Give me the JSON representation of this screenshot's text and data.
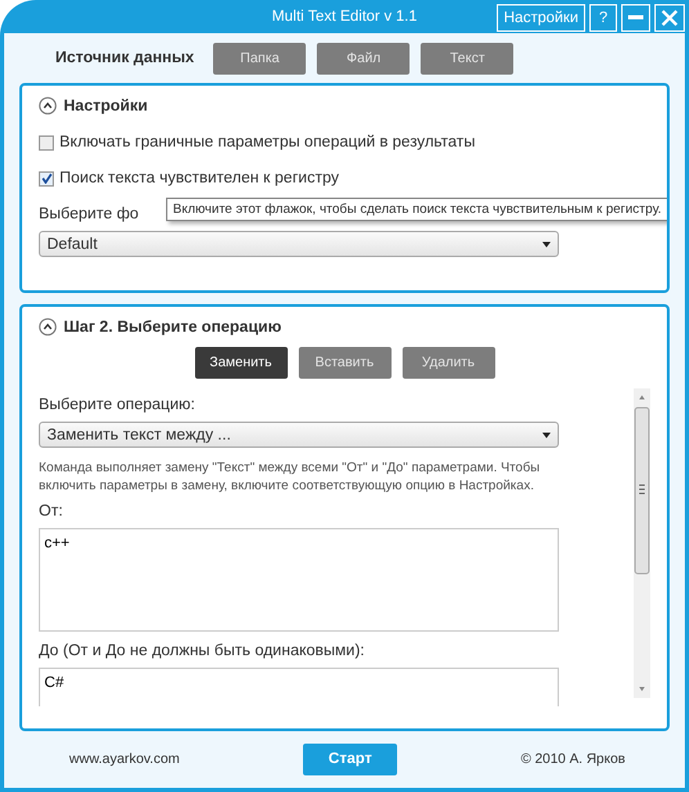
{
  "window": {
    "title": "Multi Text Editor v 1.1",
    "buttons": [
      {
        "kind": "text",
        "label": "Настройки"
      },
      {
        "kind": "text",
        "label": "?"
      },
      {
        "kind": "minimize"
      },
      {
        "kind": "close"
      }
    ]
  },
  "data_source": {
    "label": "Источник данных",
    "buttons": [
      {
        "label": "Папка",
        "disabled": true
      },
      {
        "label": "Файл",
        "disabled": true
      },
      {
        "label": "Текст",
        "disabled": true
      }
    ]
  },
  "settings": {
    "title": "Настройки",
    "expanded": true,
    "checkboxes": [
      {
        "label": "Включать граничные параметры операций в результаты",
        "checked": false
      },
      {
        "label": "Поиск текста чувствителен к регистру",
        "checked": true
      }
    ],
    "format_label": "Выберите фо",
    "tooltip": "Включите этот флажок, чтобы сделать поиск текста чувствительным к регистру.",
    "format_select": "Default"
  },
  "step2": {
    "title": "Шаг 2. Выберите операцию",
    "expanded": true,
    "operations": [
      {
        "label": "Заменить",
        "selected": true
      },
      {
        "label": "Вставить",
        "selected": false
      },
      {
        "label": "Удалить",
        "selected": false
      }
    ],
    "operation_label": "Выберите операцию:",
    "operation_select": "Заменить текст между ...",
    "description": "Команда выполняет замену \"Текст\" между всеми \"От\" и \"До\" параметрами. Чтобы включить параметры в замену, включите соответствующую опцию в Настройках.",
    "from_label": "От:",
    "from_value": "c++",
    "to_label": "До (От и До не должны быть одинаковыми):",
    "to_value": "C#"
  },
  "footer": {
    "website": "www.ayarkov.com",
    "start": "Старт",
    "copyright": "© 2010 А. Ярков"
  }
}
